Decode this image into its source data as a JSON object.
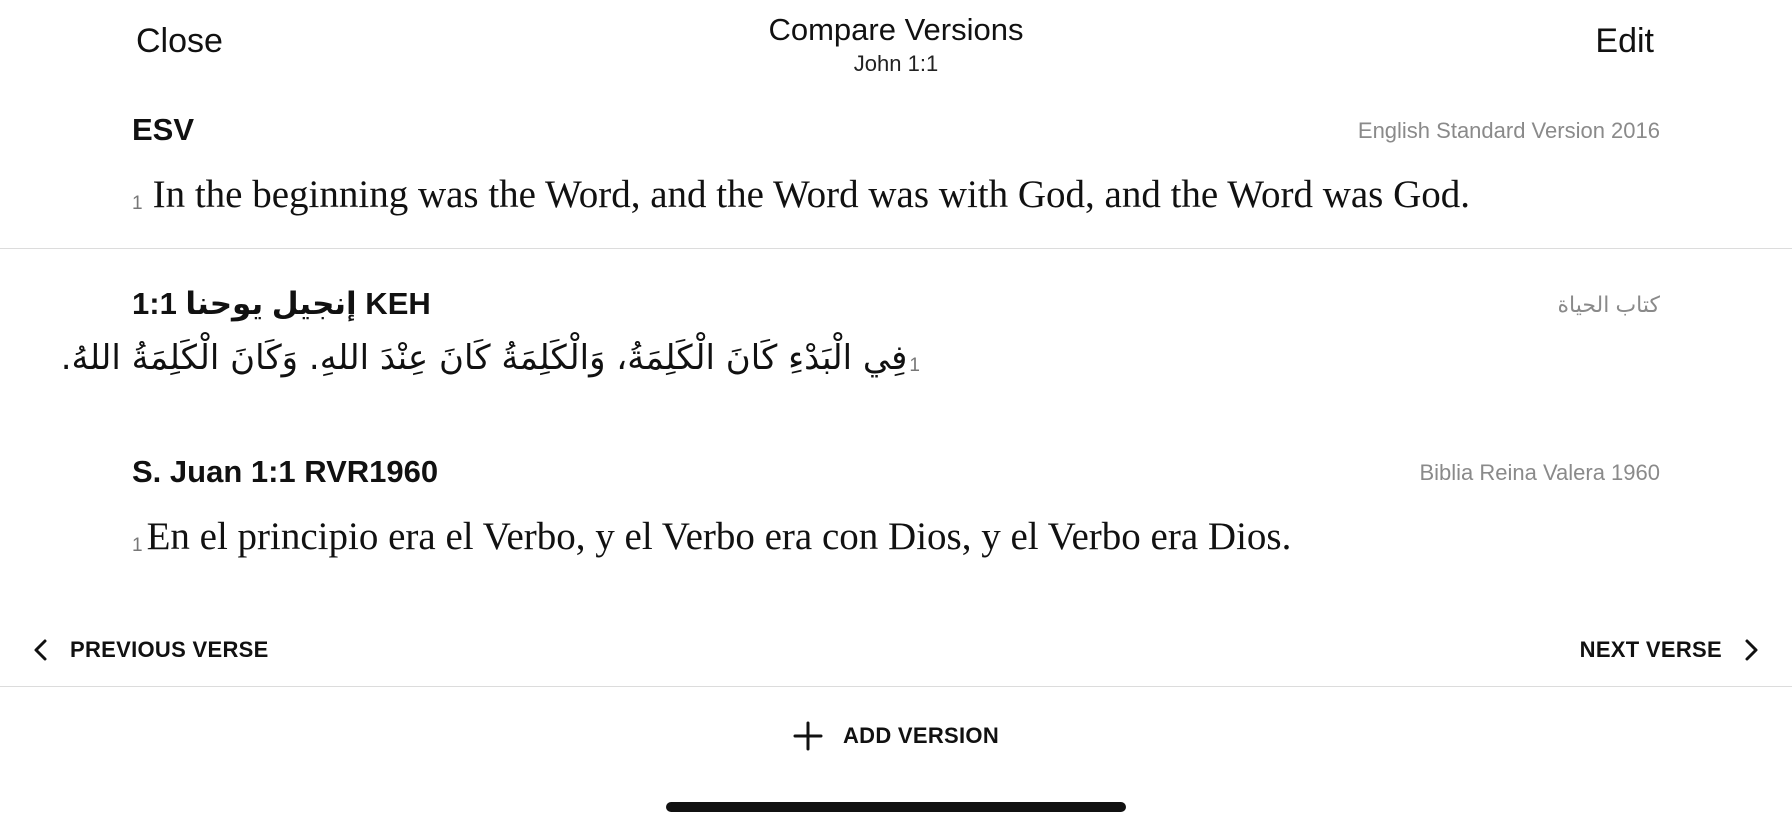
{
  "header": {
    "close_label": "Close",
    "title": "Compare Versions",
    "subtitle": "John 1:1",
    "edit_label": "Edit"
  },
  "versions": [
    {
      "abbr": "ESV",
      "full_name": "English Standard Version 2016",
      "verse_number": "1",
      "text": "In the beginning was the Word, and the Word was with God, and the Word was God."
    },
    {
      "abbr": "إنجيل يوحنا 1:1 KEH",
      "full_name": "كتاب الحياة",
      "verse_number": "1",
      "text": "فِي الْبَدْءِ كَانَ الْكَلِمَةُ، وَالْكَلِمَةُ كَانَ عِنْدَ اللهِ. وَكَانَ الْكَلِمَةُ اللهُ."
    },
    {
      "abbr": "S. Juan 1:1 RVR1960",
      "full_name": "Biblia Reina Valera 1960",
      "verse_number": "1",
      "text": "En el principio era el Verbo, y el Verbo era con Dios, y el Verbo era Dios."
    }
  ],
  "nav": {
    "previous_label": "PREVIOUS VERSE",
    "next_label": "NEXT VERSE"
  },
  "footer": {
    "add_version_label": "ADD VERSION"
  },
  "icons": {
    "previous": "chevron-left-icon",
    "next": "chevron-right-icon",
    "add": "plus-icon"
  }
}
